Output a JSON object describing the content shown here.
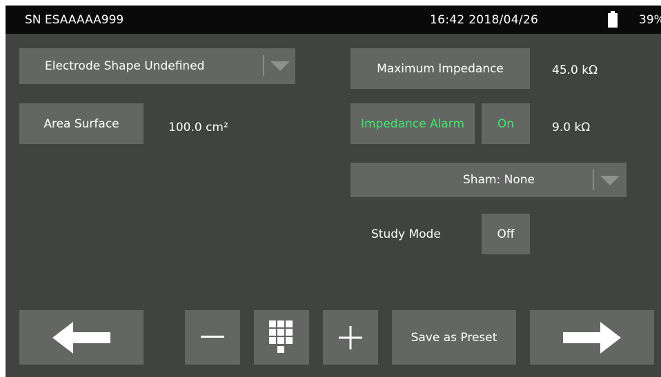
{
  "status_bar": {
    "serial": "SN ESAAAAA999",
    "datetime": "16:42 2018/04/26",
    "battery_percent": "39%",
    "battery_icon": "battery-icon"
  },
  "left_panel": {
    "electrode_shape_label": "Electrode Shape Undefined",
    "area_surface_label": "Area Surface",
    "area_surface_value": "100.0 cm²"
  },
  "right_panel": {
    "max_impedance_label": "Maximum Impedance",
    "max_impedance_value": "45.0 kΩ",
    "impedance_alarm_label": "Impedance Alarm",
    "impedance_alarm_state": "On",
    "impedance_alarm_value": "9.0 kΩ",
    "sham_label": "Sham: None",
    "study_mode_label": "Study Mode",
    "study_mode_state": "Off"
  },
  "toolbar": {
    "back_icon": "arrow-left-icon",
    "minus_icon": "minus-icon",
    "keypad_icon": "keypad-icon",
    "plus_icon": "plus-icon",
    "save_preset_label": "Save as Preset",
    "next_icon": "arrow-right-icon"
  },
  "colors": {
    "background": "#404340",
    "button": "#646664",
    "status_bar": "#0a0a0a",
    "active_text": "#3ee66a",
    "text": "#ffffff"
  }
}
